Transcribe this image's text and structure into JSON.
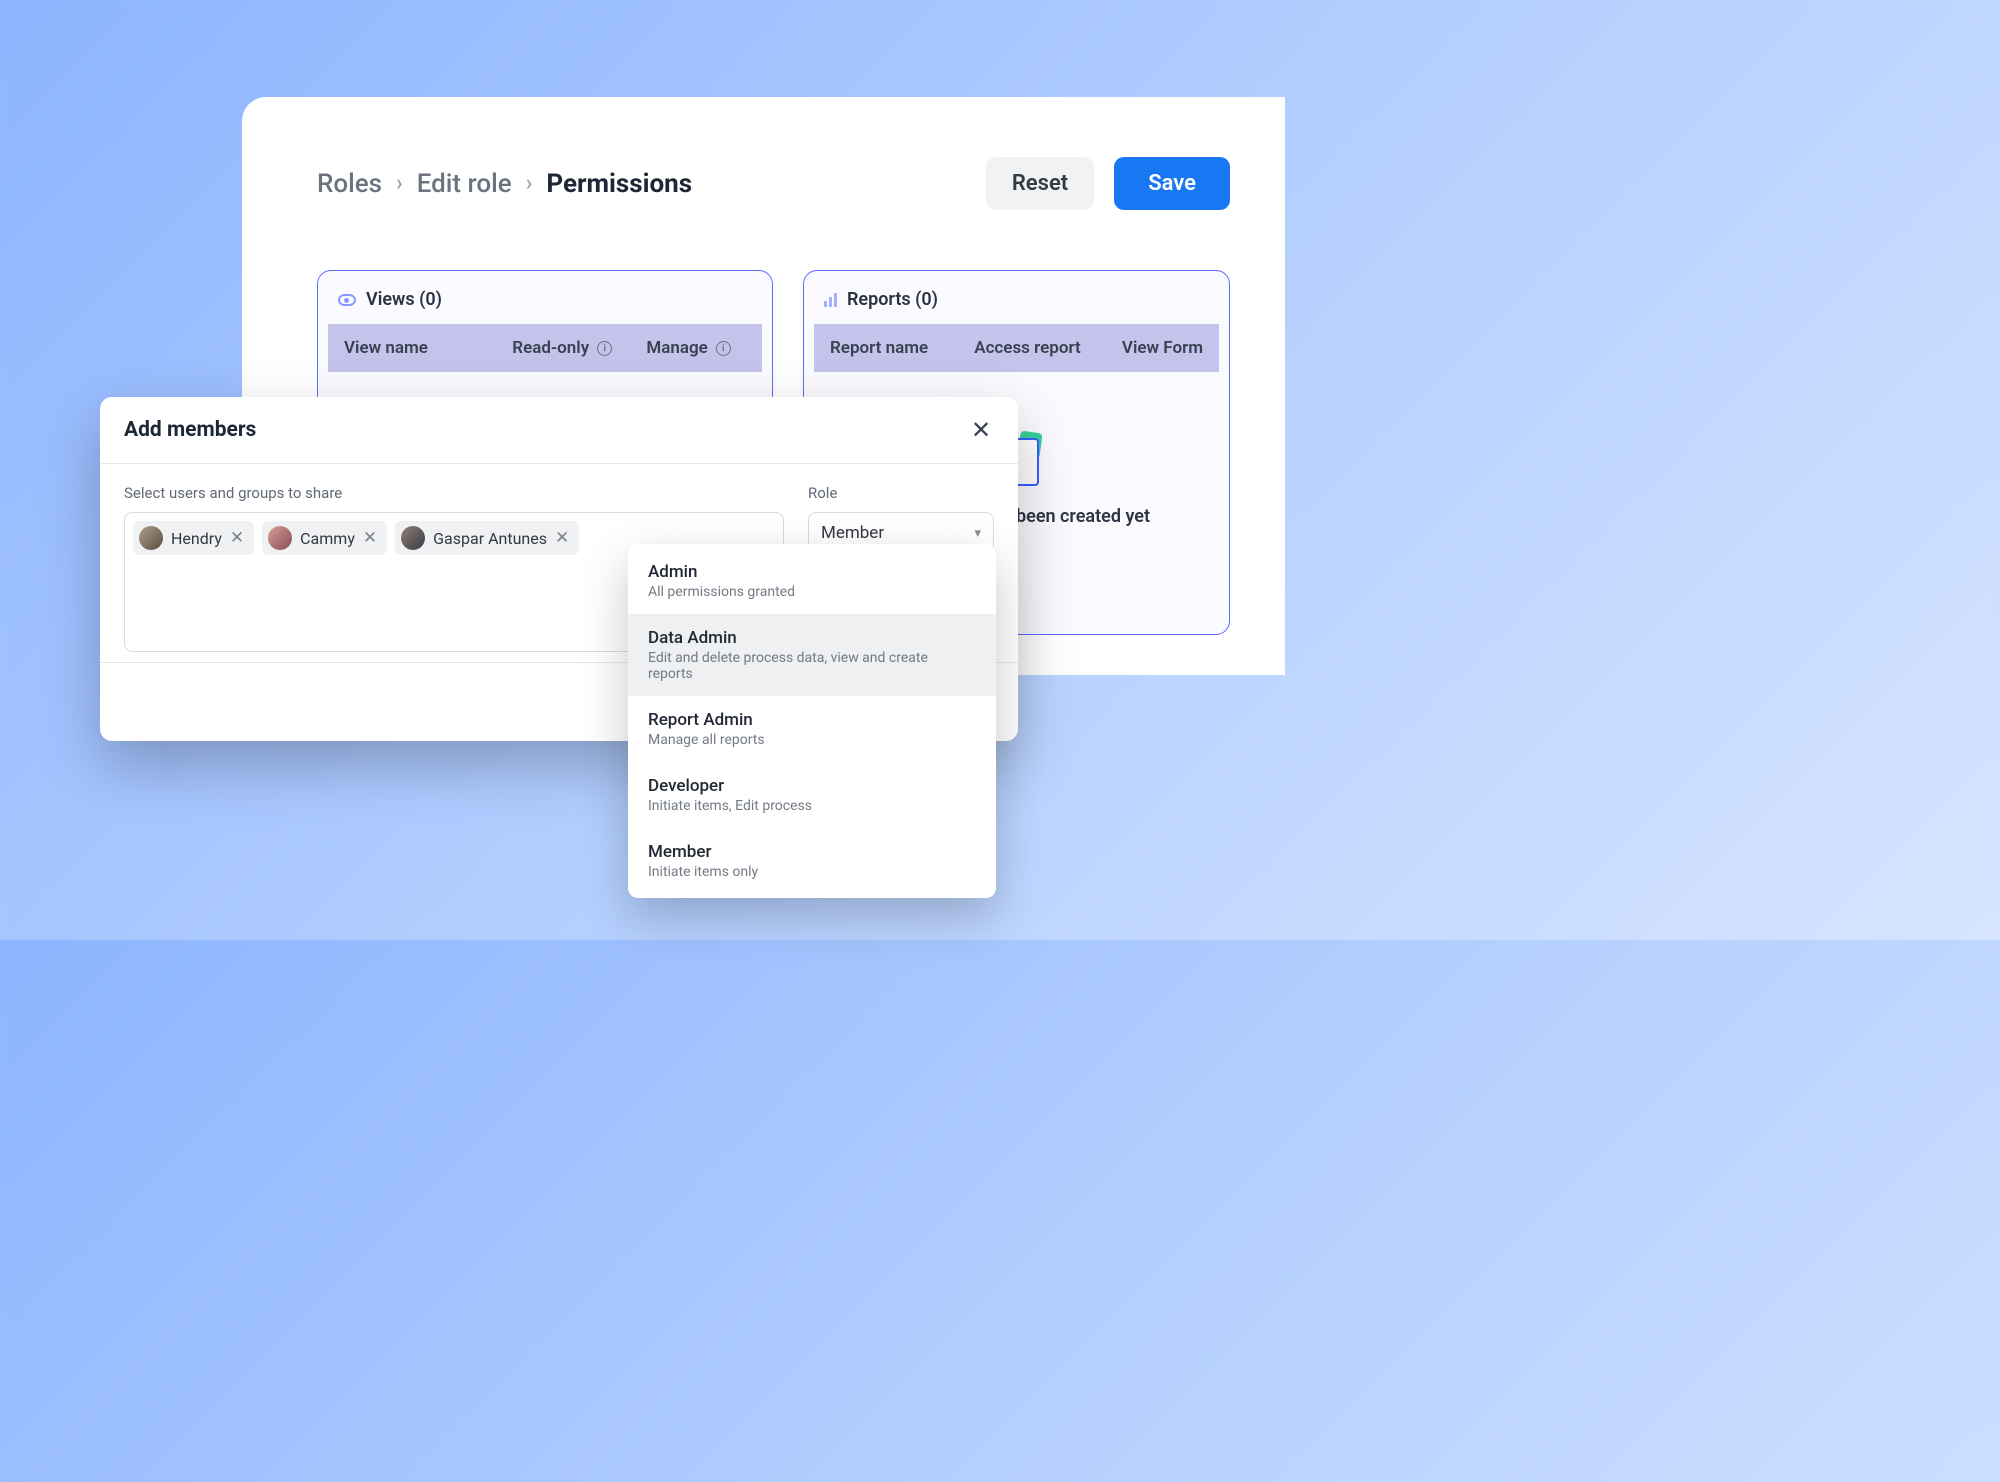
{
  "breadcrumb": {
    "roles": "Roles",
    "edit_role": "Edit role",
    "permissions": "Permissions"
  },
  "buttons": {
    "reset": "Reset",
    "save": "Save"
  },
  "views_panel": {
    "title": "Views (0)",
    "cols": {
      "name": "View name",
      "readonly": "Read-only",
      "manage": "Manage"
    }
  },
  "reports_panel": {
    "title": "Reports (0)",
    "cols": {
      "name": "Report name",
      "access": "Access report",
      "viewform": "View Form"
    },
    "empty": "No reports have been created yet"
  },
  "modal": {
    "title": "Add members",
    "select_label": "Select users and groups to share",
    "role_label": "Role",
    "role_value": "Member",
    "tokens": [
      {
        "name": "Hendry"
      },
      {
        "name": "Cammy"
      },
      {
        "name": "Gaspar Antunes"
      }
    ]
  },
  "dropdown": [
    {
      "title": "Admin",
      "sub": "All permissions granted",
      "highlight": false
    },
    {
      "title": "Data Admin",
      "sub": "Edit and delete process data, view and create reports",
      "highlight": true
    },
    {
      "title": "Report Admin",
      "sub": "Manage all reports",
      "highlight": false
    },
    {
      "title": "Developer",
      "sub": "Initiate items, Edit process",
      "highlight": false
    },
    {
      "title": "Member",
      "sub": "Initiate items only",
      "highlight": false
    }
  ]
}
